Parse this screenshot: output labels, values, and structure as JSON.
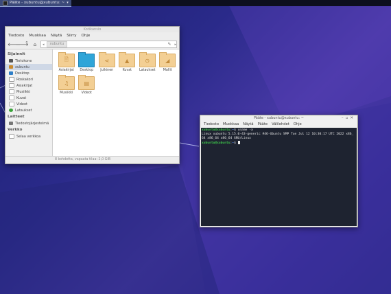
{
  "colors": {
    "terminal_bg": "#1e2330",
    "prompt_user": "#3ec94a",
    "prompt_path": "#5a8ff0",
    "folder": "#f3cf94",
    "desktop_folder": "#2fa5d8"
  },
  "panel": {
    "task_label": "Pääte - xubuntu@xubuntu: ~"
  },
  "file_manager": {
    "title": "Kotikansio",
    "menu": [
      "Tiedosto",
      "Muokkaa",
      "Näytä",
      "Siirry",
      "Ohje"
    ],
    "path_crumb": "xubuntu",
    "sidebar": {
      "places_heading": "Sijainnit",
      "places": [
        {
          "label": "Tietokone",
          "icon": "computer-icon"
        },
        {
          "label": "xubuntu",
          "icon": "home-folder-icon"
        },
        {
          "label": "Desktop",
          "icon": "desktop-icon"
        },
        {
          "label": "Roskakori",
          "icon": "trash-icon"
        },
        {
          "label": "Asiakirjat",
          "icon": "documents-icon"
        },
        {
          "label": "Musiikki",
          "icon": "music-icon"
        },
        {
          "label": "Kuvat",
          "icon": "pictures-icon"
        },
        {
          "label": "Videot",
          "icon": "videos-icon"
        },
        {
          "label": "Lataukset",
          "icon": "downloads-icon"
        }
      ],
      "devices_heading": "Laitteet",
      "devices": [
        {
          "label": "Tiedostojärjestelmä",
          "icon": "drive-icon"
        }
      ],
      "network_heading": "Verkko",
      "network": [
        {
          "label": "Selaa verkkoa",
          "icon": "network-icon"
        }
      ]
    },
    "files": [
      {
        "label": "Asiakirjat",
        "icon": "document-folder-icon",
        "glyph": "🗎"
      },
      {
        "label": "Desktop",
        "icon": "desktop-folder-icon",
        "glyph": ""
      },
      {
        "label": "Julkinen",
        "icon": "share-folder-icon",
        "glyph": "⋖"
      },
      {
        "label": "Kuvat",
        "icon": "pictures-folder-icon",
        "glyph": "▲"
      },
      {
        "label": "Lataukset",
        "icon": "downloads-folder-icon",
        "glyph": "⊙"
      },
      {
        "label": "Mallit",
        "icon": "templates-folder-icon",
        "glyph": "◢"
      },
      {
        "label": "Musiikki",
        "icon": "music-folder-icon",
        "glyph": "♫"
      },
      {
        "label": "Videot",
        "icon": "videos-folder-icon",
        "glyph": "▤"
      }
    ],
    "status": "8 kohdetta, vapaata tilaa: 2,0 GiB"
  },
  "terminal": {
    "title": "Pääte - xubuntu@xubuntu: ~",
    "menu": [
      "Tiedosto",
      "Muokkaa",
      "Näytä",
      "Pääte",
      "Välilehdet",
      "Ohje"
    ],
    "prompt_user": "xubuntu@xubuntu",
    "prompt_sep": ":",
    "prompt_path": "~",
    "prompt_symbol": "$",
    "command": " uname -a",
    "output_1": "Linux xubuntu 5.15.0-43-generic #46-Ubuntu SMP Tue Jul 12 10:30:17 UTC 2022 x86_",
    "output_2": "64 x86_64 x86_64 GNU/Linux"
  }
}
